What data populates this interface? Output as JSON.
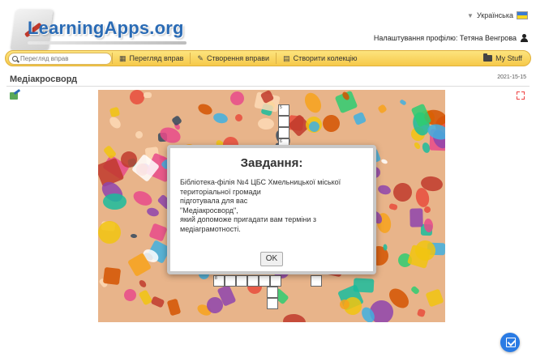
{
  "header": {
    "logo_text": "LearningApps.org",
    "language": "Українська",
    "profile_label": "Налаштування профілю: Тетяна Венгрова"
  },
  "toolbar": {
    "search_placeholder": "Перегляд вправ",
    "items": [
      {
        "label": "Перегляд вправ",
        "icon": "grid-icon"
      },
      {
        "label": "Створення вправи",
        "icon": "pencil-icon"
      },
      {
        "label": "Створити колекцію",
        "icon": "collection-icon"
      }
    ],
    "my_stuff_label": "My Stuff"
  },
  "page": {
    "title": "Медіакросворд",
    "date": "2021-15-15"
  },
  "modal": {
    "heading": "Завдання:",
    "text": "Бібліотека-філія №4 ЦБС Хмельницької міської\nтериторіальної громади\nпідготувала для вас\n\"Медіакросворд\",\nякий допоможе пригадати вам терміни з\nмедіаграмотності.",
    "ok_label": "OK"
  },
  "crossword": {
    "numbers": [
      "5",
      "6",
      "8"
    ]
  },
  "colors": {
    "accent": "#2a6bb5",
    "toolbar": "#f6c94a",
    "check_button": "#2a7be4"
  }
}
